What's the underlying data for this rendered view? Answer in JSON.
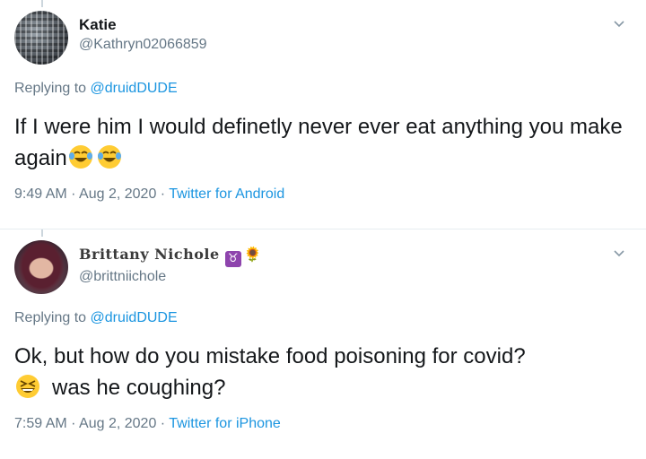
{
  "tweets": [
    {
      "name": "Katie",
      "handle": "@Kathryn02066859",
      "replying_prefix": "Replying to",
      "replying_to": "@druidDUDE",
      "text": "If I were him I would definetly never ever eat anything you make again",
      "emojis_after": [
        "face-with-tears-of-joy-icon",
        "face-with-tears-of-joy-icon"
      ],
      "time": "9:49 AM",
      "date": "Aug 2, 2020",
      "source": "Twitter for Android",
      "separator": "·"
    },
    {
      "name": "Brittany Nichole",
      "badge": "♉",
      "flower": "🌻",
      "handle": "@brittniichole",
      "replying_prefix": "Replying to",
      "replying_to": "@druidDUDE",
      "text_line1": "Ok, but how do you mistake food poisoning for covid?",
      "text_line2": "was he coughing?",
      "time": "7:59 AM",
      "date": "Aug 2, 2020",
      "source": "Twitter for iPhone",
      "separator": "·"
    }
  ],
  "colors": {
    "link": "#1b95e0",
    "secondary": "#657786",
    "divider": "#e6ecf0",
    "text": "#14171a",
    "badge": "#8e44ad"
  }
}
